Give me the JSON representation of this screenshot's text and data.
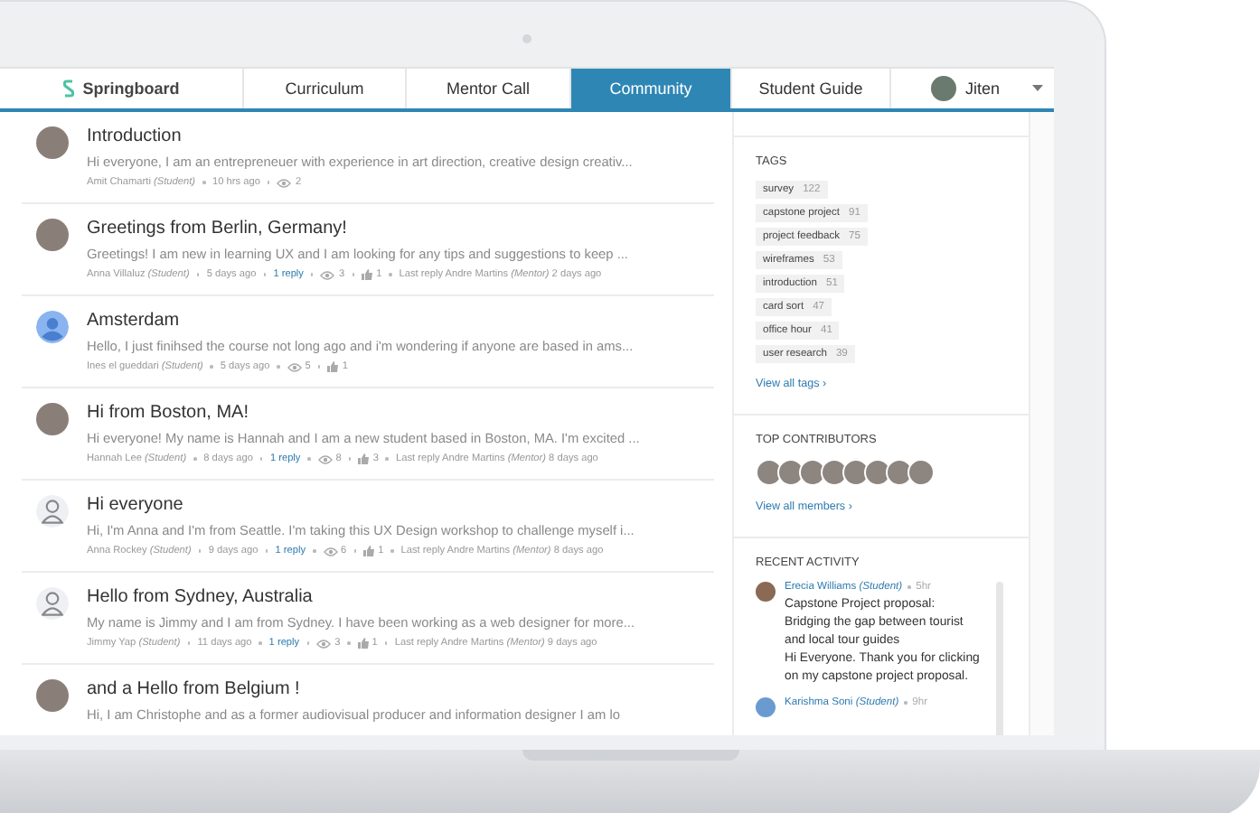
{
  "nav": {
    "logo": "Springboard",
    "tabs": [
      {
        "label": "Curriculum",
        "selected": false
      },
      {
        "label": "Mentor Call",
        "selected": false
      },
      {
        "label": "Community",
        "selected": true
      },
      {
        "label": "Student Guide",
        "selected": false
      }
    ],
    "user": "Jiten"
  },
  "posts": [
    {
      "avatar": {
        "kind": "photo"
      },
      "title": "Introduction",
      "snippet": "Hi everyone, I am an entrepreneuer with experience in art direction, creative design creativ...",
      "author": "Amit Chamarti *(Student)*",
      "time": "10 hrs ago",
      "views": "2"
    },
    {
      "avatar": {
        "kind": "photo"
      },
      "title": "Greetings from Berlin, Germany!",
      "snippet": "Greetings! I am new in learning UX and I am looking for any tips and suggestions to keep ...",
      "author": "Anna Villaluz *(Student)*",
      "time": "5 days ago",
      "replies": "1 reply",
      "views": "3",
      "likes": "1",
      "last_reply": "Last reply Andre Martins *(Mentor)* 2 days ago"
    },
    {
      "avatar": {
        "kind": "default"
      },
      "title": "Amsterdam",
      "snippet": "Hello, I just finihsed the course not long ago and i'm wondering if anyone are based in ams...",
      "author": "Ines el gueddari *(Student)*",
      "time": "5 days ago",
      "views": "5",
      "likes": "1"
    },
    {
      "avatar": {
        "kind": "photo"
      },
      "title": "Hi from Boston, MA!",
      "snippet": "Hi everyone! My name is Hannah and I am a new student based in Boston, MA. I'm excited ...",
      "author": "Hannah Lee *(Student)*",
      "time": "8 days ago",
      "replies": "1 reply",
      "views": "8",
      "likes": "3",
      "last_reply": "Last reply Andre Martins *(Mentor)* 8 days ago"
    },
    {
      "avatar": {
        "kind": "outline"
      },
      "title": "Hi everyone",
      "snippet": "Hi, I'm Anna and I'm from Seattle. I'm taking this UX Design workshop to challenge myself i...",
      "author": "Anna Rockey *(Student)*",
      "time": "9 days ago",
      "replies": "1 reply",
      "views": "6",
      "likes": "1",
      "last_reply": "Last reply Andre Martins *(Mentor)* 8 days ago"
    },
    {
      "avatar": {
        "kind": "outline"
      },
      "title": "Hello from Sydney, Australia",
      "snippet": "My name is Jimmy and I am from Sydney. I have been working as a web designer for more...",
      "author": "Jimmy Yap *(Student)*",
      "time": "11 days ago",
      "replies": "1 reply",
      "views": "3",
      "likes": "1",
      "last_reply": "Last reply Andre Martins *(Mentor)* 9 days ago"
    },
    {
      "avatar": {
        "kind": "photo"
      },
      "title": "and a Hello from Belgium !",
      "snippet": "Hi, I am Christophe and as a former audiovisual producer and information designer I am lo"
    }
  ],
  "sidebar": {
    "tags_title": "TAGS",
    "tags": [
      {
        "label": "survey",
        "count": "122"
      },
      {
        "label": "capstone project",
        "count": "91"
      },
      {
        "label": "project feedback",
        "count": "75"
      },
      {
        "label": "wireframes",
        "count": "53"
      },
      {
        "label": "introduction",
        "count": "51"
      },
      {
        "label": "card sort",
        "count": "47"
      },
      {
        "label": "office hour",
        "count": "41"
      },
      {
        "label": "user research",
        "count": "39"
      }
    ],
    "view_all_tags": "View all tags ›",
    "contributors_title": "TOP CONTRIBUTORS",
    "view_all_members": "View all members ›",
    "activity_title": "RECENT ACTIVITY",
    "activity": [
      {
        "name": "Erecia Williams *(Student)*",
        "time": "5hr",
        "title": "Capstone Project proposal: Bridging the gap between tourist and local tour guides",
        "text": "Hi Everyone. Thank you for clicking on my capstone project proposal."
      },
      {
        "name": "Karishma Soni *(Student)*",
        "time": "9hr"
      }
    ]
  }
}
